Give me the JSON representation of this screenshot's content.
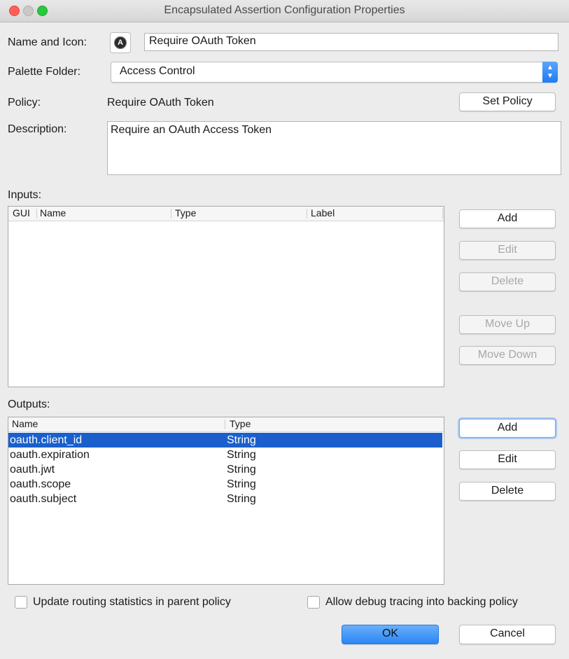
{
  "window": {
    "title": "Encapsulated Assertion Configuration Properties"
  },
  "form": {
    "name_label": "Name and Icon:",
    "name_value": "Require OAuth Token",
    "icon_glyph": "A",
    "palette_label": "Palette Folder:",
    "palette_value": "Access Control",
    "policy_label": "Policy:",
    "policy_value": "Require OAuth Token",
    "set_policy_label": "Set Policy",
    "description_label": "Description:",
    "description_value": "Require an OAuth Access Token"
  },
  "inputs": {
    "label": "Inputs:",
    "columns": [
      "GUI",
      "Name",
      "Type",
      "Label"
    ],
    "buttons": {
      "add": "Add",
      "edit": "Edit",
      "delete": "Delete",
      "move_up": "Move Up",
      "move_down": "Move Down"
    }
  },
  "outputs": {
    "label": "Outputs:",
    "columns": [
      "Name",
      "Type"
    ],
    "rows": [
      {
        "name": "oauth.client_id",
        "type": "String",
        "selected": true
      },
      {
        "name": "oauth.expiration",
        "type": "String"
      },
      {
        "name": "oauth.jwt",
        "type": "String"
      },
      {
        "name": "oauth.scope",
        "type": "String"
      },
      {
        "name": "oauth.subject",
        "type": "String"
      }
    ],
    "buttons": {
      "add": "Add",
      "edit": "Edit",
      "delete": "Delete"
    }
  },
  "options": {
    "update_routing": "Update routing statistics in parent policy",
    "allow_debug": "Allow debug tracing into backing policy"
  },
  "footer": {
    "ok": "OK",
    "cancel": "Cancel"
  },
  "colors": {
    "selection": "#1a5fcc",
    "primary_button": "#2a86f5"
  }
}
